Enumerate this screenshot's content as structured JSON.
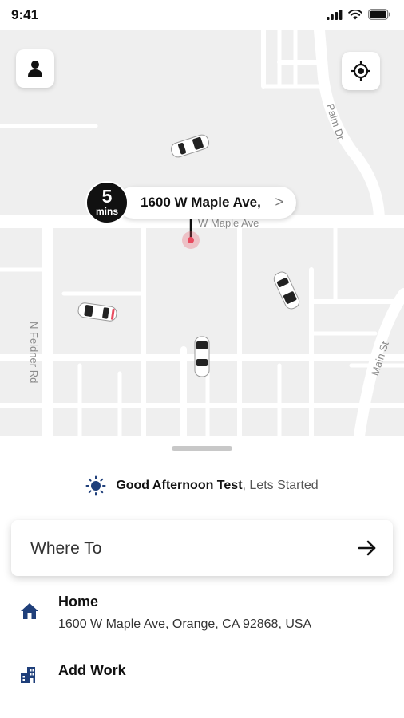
{
  "status_bar": {
    "time": "9:41",
    "icons": [
      "cellular-signal-icon",
      "wifi-icon",
      "battery-icon"
    ]
  },
  "map": {
    "street_labels": {
      "palm": "Palm Dr",
      "feldner": "N Feldner Rd",
      "main": "Main St",
      "maple": "W Maple Ave"
    },
    "eta": {
      "minutes": "5",
      "unit": "mins",
      "address": "1600 W Maple Ave,",
      "chevron": ">"
    },
    "profile_icon": "person-icon",
    "locate_icon": "crosshair-icon",
    "cars": [
      "car-icon",
      "car-icon",
      "car-icon",
      "car-icon"
    ]
  },
  "sheet": {
    "greeting_bold": "Good Afternoon Test",
    "greeting_rest": ", Lets Started",
    "greeting_icon": "sun-icon",
    "where_to": "Where To",
    "home": {
      "title": "Home",
      "address": "1600 W Maple Ave, Orange, CA 92868, USA",
      "icon": "home-icon"
    },
    "work": {
      "title": "Add Work",
      "icon": "office-building-icon"
    }
  },
  "colors": {
    "accent": "#1f3f7a",
    "pin": "#e84b5f",
    "map_background": "#efefef",
    "road": "#ffffff"
  }
}
